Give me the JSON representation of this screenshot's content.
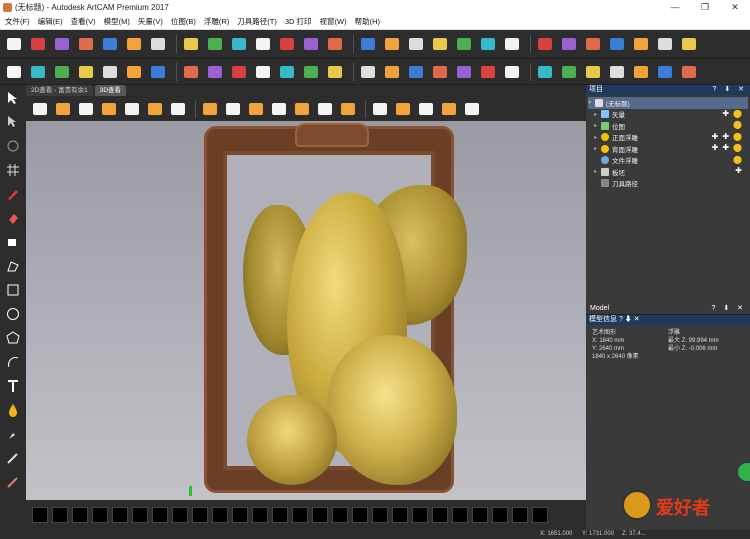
{
  "window": {
    "title": "(无标题) - Autodesk ArtCAM Premium 2017",
    "controls": [
      "—",
      "❐",
      "✕"
    ]
  },
  "menu": [
    "文件(F)",
    "编辑(E)",
    "查看(V)",
    "模型(M)",
    "矢量(V)",
    "位图(B)",
    "浮雕(R)",
    "刀具路径(T)",
    "3D 打印",
    "视窗(W)",
    "帮助(H)"
  ],
  "toolbar_rows": {
    "row1": [
      "new-file",
      "open-file",
      "save",
      "cut",
      "copy",
      "paste",
      "undo",
      "redo",
      "notes",
      "model-size",
      "grid",
      "flag",
      "speed",
      "fill",
      "transform",
      "layers",
      "folder",
      "vector",
      "wand",
      "smooth",
      "emboss",
      "texture",
      "cube",
      "stamp",
      "relief-tool",
      "nodes",
      "align",
      "polyline"
    ],
    "row2": [
      "zoom",
      "spiral",
      "blue-shape",
      "eraser",
      "pyramid",
      "grid-cube",
      "waffle",
      "block",
      "star",
      "flat",
      "arrow",
      "diamond",
      "wave",
      "layer",
      "stack",
      "plane",
      "half",
      "slice",
      "tile",
      "split",
      "pyramid2",
      "tiles",
      "plus",
      "bottle",
      "circle",
      "frame",
      "square",
      "square2"
    ]
  },
  "document": {
    "tabs": [
      "2D查看 - 富贵有余1",
      "3D查看"
    ]
  },
  "view_toolbar": [
    "zoom",
    "bulb",
    "cube-white",
    "axes",
    "cube-front",
    "cube-side",
    "cube-iso",
    "cylinder",
    "box",
    "open-box",
    "intersect",
    "star-blue",
    "cube-blue",
    "shade-red",
    "diamond-yellow",
    "hexagon-green",
    "star-light",
    "cube-colors",
    "rainbow"
  ],
  "project_panel": {
    "title": "项目",
    "header_buttons": "? ⬇ ✕",
    "tree": [
      {
        "label": "(无标题)",
        "selected": true
      },
      {
        "label": "矢量",
        "icon": "#7fc2ff"
      },
      {
        "label": "位图",
        "icon": "#7ec87e"
      },
      {
        "label": "正面浮雕",
        "icon": "#f4c200"
      },
      {
        "label": "背面浮雕",
        "icon": "#f4c200"
      },
      {
        "label": "文件浮雕",
        "icon": "#6fa8dc"
      },
      {
        "label": "板坯",
        "icon": "#ccc"
      },
      {
        "label": "刀具路径",
        "icon": "#888"
      }
    ]
  },
  "model_panel": {
    "title": "Model",
    "info_title": "模型信息",
    "left": {
      "heading": "艺术图形",
      "x": "X: 1840 mm",
      "y": "Y: 2640 mm",
      "px": "1840 x 2640 像素"
    },
    "right": {
      "heading": "浮雕",
      "max_z": "最大 Z: 99.994 mm",
      "min_z": "最小 Z: -0.006 mm"
    }
  },
  "status": {
    "x": "X: 1651.000",
    "y": "Y: 1731.000",
    "z": "Z: 37.4..."
  },
  "watermark": "爱好者",
  "colors": {
    "panel_header": "#1e3a5e",
    "viewport_bg": "#a9a9b1",
    "relief_gold": "#c9aa3e",
    "frame_brown": "#6b3e26"
  }
}
